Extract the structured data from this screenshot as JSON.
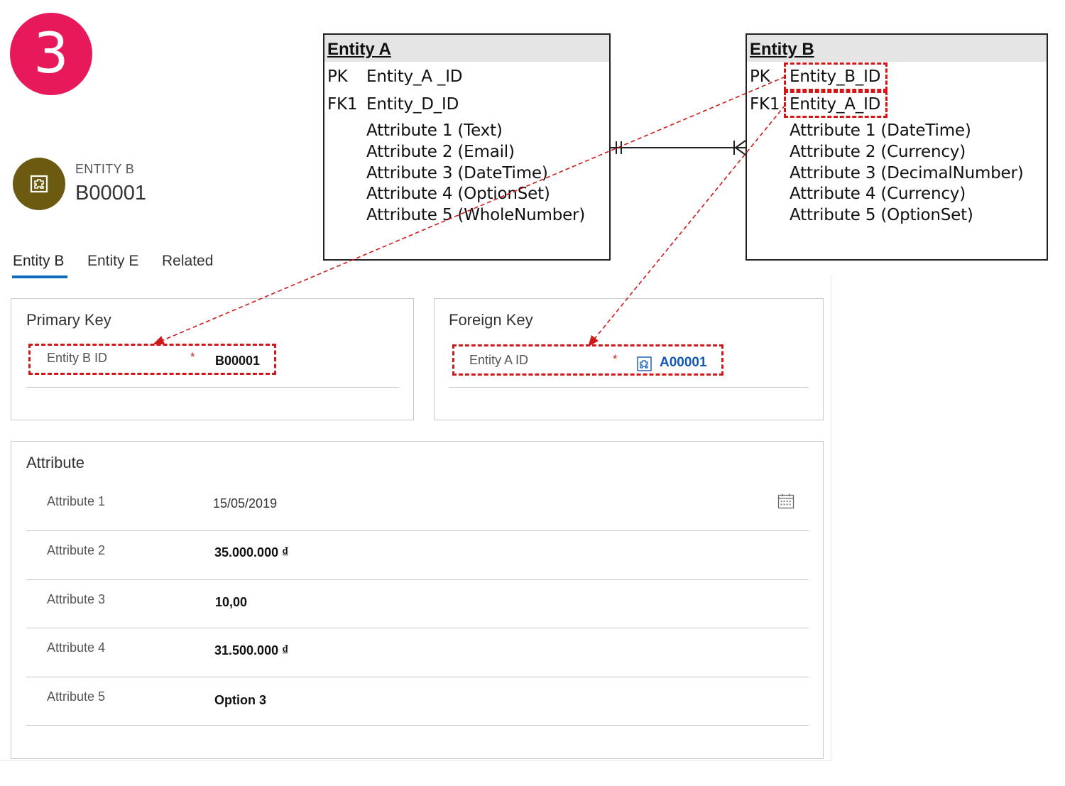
{
  "step": "3",
  "record": {
    "type_label": "ENTITY B",
    "name": "B00001"
  },
  "tabs": [
    {
      "label": "Entity B"
    },
    {
      "label": "Entity E"
    },
    {
      "label": "Related"
    }
  ],
  "primary_key_section": {
    "title": "Primary Key",
    "field_label": "Entity B ID",
    "required_marker": "*",
    "value": "B00001"
  },
  "foreign_key_section": {
    "title": "Foreign Key",
    "field_label": "Entity A ID",
    "required_marker": "*",
    "value": "A00001"
  },
  "attribute_section": {
    "title": "Attribute",
    "rows": [
      {
        "label": "Attribute 1",
        "value": "15/05/2019"
      },
      {
        "label": "Attribute 2",
        "value": "35.000.000 ₫"
      },
      {
        "label": "Attribute 3",
        "value": "10,00"
      },
      {
        "label": "Attribute 4",
        "value": "31.500.000 ₫"
      },
      {
        "label": "Attribute 5",
        "value": "Option 3"
      }
    ]
  },
  "entity_a": {
    "title": "Entity A",
    "pk_key": "PK",
    "pk_field": "Entity_A _ID",
    "fk_key": "FK1",
    "fk_field": "Entity_D_ID",
    "attributes": [
      "Attribute 1 (Text)",
      "Attribute 2 (Email)",
      "Attribute 3 (DateTime)",
      "Attribute 4 (OptionSet)",
      "Attribute 5 (WholeNumber)"
    ]
  },
  "entity_b": {
    "title": "Entity B",
    "pk_key": "PK",
    "pk_field": "Entity_B_ID",
    "fk_key": "FK1",
    "fk_field": "Entity_A_ID",
    "attributes": [
      "Attribute 1 (DateTime)",
      "Attribute 2 (Currency)",
      "Attribute 3 (DecimalNumber)",
      "Attribute 4 (Currency)",
      "Attribute 5 (OptionSet)"
    ]
  },
  "colors": {
    "step_badge": "#e8195a",
    "avatar": "#6b5a10",
    "tab_accent": "#0f6cbd",
    "highlight": "#d01818",
    "link": "#1157b3"
  }
}
